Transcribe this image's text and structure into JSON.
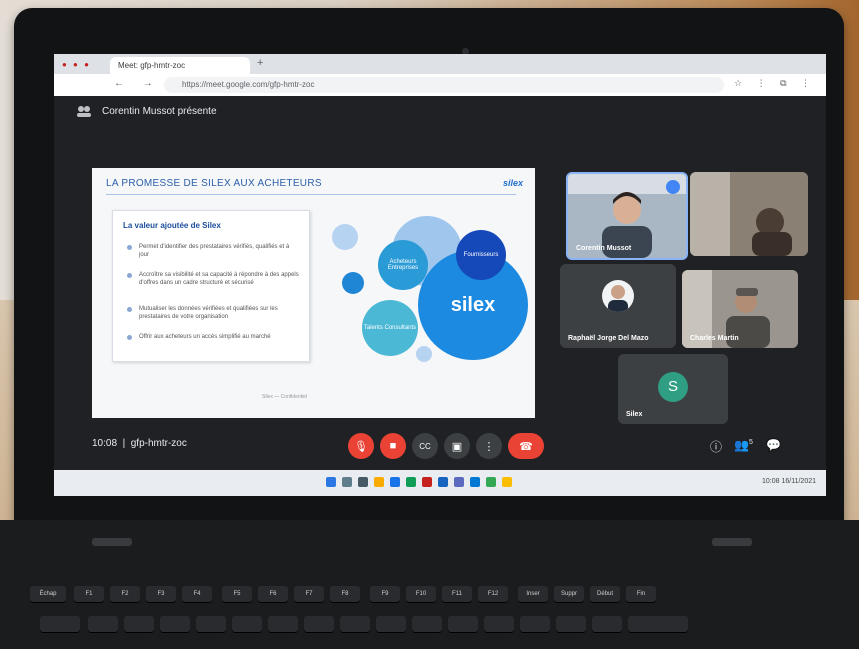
{
  "browser": {
    "tab_title": "Meet: gfp-hmtr-zoc",
    "url": "https://meet.google.com/gfp-hmtr-zoc"
  },
  "meet": {
    "presenter_text": "Corentin Mussot présente",
    "meeting_time": "10:08",
    "meeting_code": "gfp-hmtr-zoc"
  },
  "slide": {
    "title": "LA PROMESSE DE SILEX AUX ACHETEURS",
    "corner_logo": "silex",
    "card_heading": "La valeur ajoutée de Silex",
    "bullets": [
      "Permet d'identifier des prestataires vérifiés, qualifiés et à jour",
      "Accroître sa visibilité et sa capacité à répondre à des appels d'offres dans un cadre structuré et sécurisé",
      "Mutualiser les données vérifiées et qualifiées sur les prestataires de votre organisation",
      "Offrir aux acheteurs un accès simplifié au marché"
    ],
    "bubbles": {
      "left": "Acheteurs Entreprises",
      "right": "Fournisseurs",
      "bottom": "Talents Consultants",
      "center": "silex"
    },
    "footer": "Silex — Confidentiel"
  },
  "participants": [
    {
      "name": "Corentin Mussot",
      "avatar_letter": ""
    },
    {
      "name": "",
      "avatar_letter": ""
    },
    {
      "name": "Raphaël Jorge Del Mazo",
      "avatar_letter": ""
    },
    {
      "name": "Charles Martin",
      "avatar_letter": ""
    },
    {
      "name": "Silex",
      "avatar_letter": "S"
    }
  ],
  "controls": {
    "mic_icon": "mic-off-icon",
    "camera_icon": "camera-off-icon",
    "captions_icon": "cc-icon",
    "present_icon": "present-icon",
    "more_icon": "more-icon",
    "hangup_icon": "hangup-icon",
    "colors": {
      "danger": "#ea4335",
      "neutral": "#3c4043"
    }
  },
  "right_controls": {
    "info_icon": "info-icon",
    "people_count": "5",
    "chat_icon": "chat-icon"
  },
  "taskbar": {
    "clock": "10:08",
    "date": "16/11/2021"
  },
  "keyboard": {
    "keys": [
      "Échap",
      "F1",
      "F2",
      "F3",
      "F4",
      "F5",
      "F6",
      "F7",
      "F8",
      "F9",
      "F10",
      "F11",
      "F12",
      "Inser",
      "Suppr",
      "Début",
      "Fin"
    ]
  }
}
